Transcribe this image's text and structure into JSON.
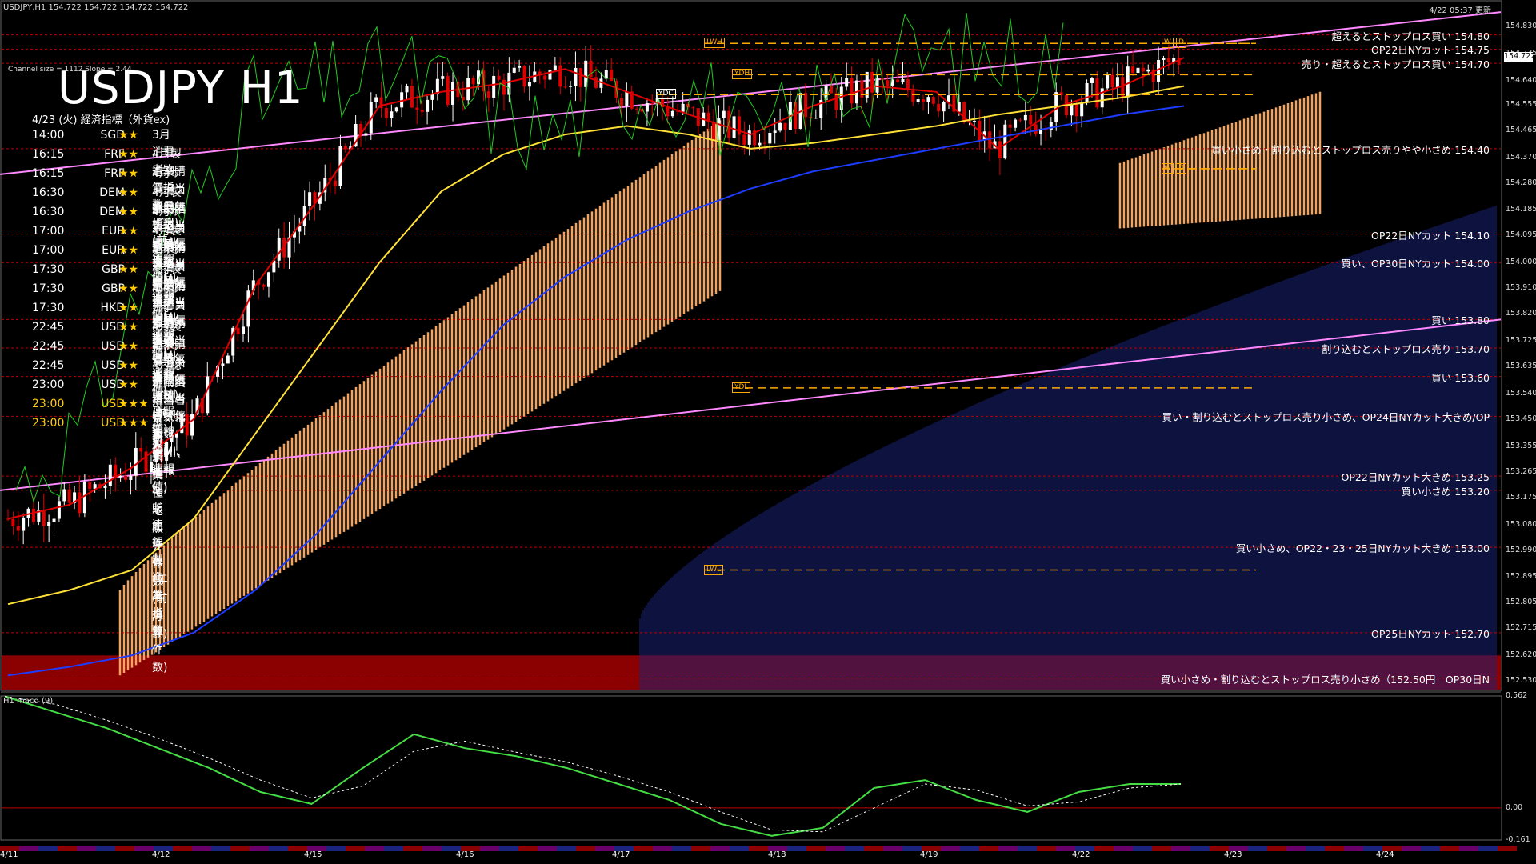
{
  "header": {
    "symbol_info": "USDJPY,H1  154.722 154.722 154.722 154.722",
    "timestamp": "4/22 05:37 更新",
    "channel_info": "Channel size = 1112 Slope = 2.44",
    "big_title": "USDJPY H1",
    "macd_label": "H1  macd (9)",
    "current_price": "154.722"
  },
  "econ": {
    "title": "4/23 (火) 経済指標（外貨ex)",
    "rows": [
      {
        "time": "14:00",
        "currency": "SGD",
        "stars": "★★",
        "event": "3月消費者物価指数(CPI)(前年比)",
        "level": "std"
      },
      {
        "time": "16:15",
        "currency": "FRF",
        "stars": "★★",
        "event": "4月製造業購買担当者景気指数(PMI、速報値)",
        "level": "std"
      },
      {
        "time": "16:15",
        "currency": "FRF",
        "stars": "★★",
        "event": "4月サービス部門購買担当者景気指数(PMI、速報値)",
        "level": "std"
      },
      {
        "time": "16:30",
        "currency": "DEM",
        "stars": "★★",
        "event": "4月製造業購買担当者景気指数(PMI、速報値)",
        "level": "std"
      },
      {
        "time": "16:30",
        "currency": "DEM",
        "stars": "★★",
        "event": "4月サービス部門購買担当者景気指数(PMI、速報値)",
        "level": "std"
      },
      {
        "time": "17:00",
        "currency": "EUR",
        "stars": "★★",
        "event": "4月製造業購買担当者景気指数(PMI、速報値)",
        "level": "std"
      },
      {
        "time": "17:00",
        "currency": "EUR",
        "stars": "★★",
        "event": "4月サービス部門購買担当者景気指数(PMI、速報値)",
        "level": "std"
      },
      {
        "time": "17:30",
        "currency": "GBP",
        "stars": "★★",
        "event": "4月製造業購買担当者景気指数(PMI、速報値)",
        "level": "std"
      },
      {
        "time": "17:30",
        "currency": "GBP",
        "stars": "★★",
        "event": "4月サービス部門購買担当者景気指数(PMI、速報値)",
        "level": "std"
      },
      {
        "time": "17:30",
        "currency": "HKD",
        "stars": "★★",
        "event": "3月消費者物価指数(CPI)(前年比)",
        "level": "std"
      },
      {
        "time": "22:45",
        "currency": "USD",
        "stars": "★★",
        "event": "4月製造業購買担当者景気指数(PMI、速報値)",
        "level": "std"
      },
      {
        "time": "22:45",
        "currency": "USD",
        "stars": "★★",
        "event": "4月サービス部門購買担当者景気指数(PMI、速報値)",
        "level": "std"
      },
      {
        "time": "22:45",
        "currency": "USD",
        "stars": "★★",
        "event": "4月総合購買担当者景気指数(PMI、速報値)",
        "level": "std"
      },
      {
        "time": "23:00",
        "currency": "USD",
        "stars": "★★",
        "event": "4月リッチモンド連銀製造業指数",
        "level": "std"
      },
      {
        "time": "23:00",
        "currency": "USD",
        "stars": "★★★",
        "event": "3月新築住宅販売件数(年率換算件数)",
        "level": "hi"
      },
      {
        "time": "23:00",
        "currency": "USD",
        "stars": "★★★",
        "event": "3月新築住宅販売件数(前月比)",
        "level": "hi"
      }
    ]
  },
  "annotations": [
    {
      "text": "超えるとストップロス買い 154.80",
      "price": 154.8
    },
    {
      "text": "OP22日NYカット 154.75",
      "price": 154.75
    },
    {
      "text": "売り・超えるとストップロス買い 154.70",
      "price": 154.7
    },
    {
      "text": "買い小さめ・割り込むとストップロス売りやや小さめ 154.40",
      "price": 154.4
    },
    {
      "text": "OP22日NYカット 154.10",
      "price": 154.1
    },
    {
      "text": "買い、OP30日NYカット 154.00",
      "price": 154.0
    },
    {
      "text": "買い 153.80",
      "price": 153.8
    },
    {
      "text": "割り込むとストップロス売り 153.70",
      "price": 153.7
    },
    {
      "text": "買い 153.60",
      "price": 153.6
    },
    {
      "text": "買い・割り込むとストップロス売り小さめ、OP24日NYカット大きめ/OP",
      "price": 153.46
    },
    {
      "text": "OP22日NYカット大きめ 153.25",
      "price": 153.25
    },
    {
      "text": "買い小さめ 153.20",
      "price": 153.2
    },
    {
      "text": "買い小さめ、OP22・23・25日NYカット大きめ 153.00",
      "price": 153.0
    },
    {
      "text": "OP25日NYカット 152.70",
      "price": 152.7
    },
    {
      "text": "買い小さめ・割り込むとストップロス売り小さめ（152.50円　OP30日N",
      "price": 152.54
    }
  ],
  "price_ticks": [
    "154.830",
    "154.735",
    "154.640",
    "154.555",
    "154.465",
    "154.370",
    "154.280",
    "154.185",
    "154.095",
    "154.000",
    "153.910",
    "153.820",
    "153.725",
    "153.635",
    "153.540",
    "153.450",
    "153.355",
    "153.265",
    "153.175",
    "153.080",
    "152.990",
    "152.895",
    "152.805",
    "152.715",
    "152.620",
    "152.530"
  ],
  "macd_ticks": [
    "0.562",
    "0.00",
    "-0.161"
  ],
  "date_ticks": [
    "4/11",
    "4/12",
    "4/15",
    "4/16",
    "4/17",
    "4/18",
    "4/19",
    "4/22",
    "4/23",
    "4/24"
  ],
  "level_boxes": [
    {
      "label": "LWH",
      "price": 154.77
    },
    {
      "label": "YDH",
      "price": 154.66
    },
    {
      "label": "YDC",
      "price": 154.59
    },
    {
      "label": "YDL",
      "price": 153.56
    },
    {
      "label": "LWL",
      "price": 152.92
    },
    {
      "label": "W",
      "price": 154.77
    },
    {
      "label": "D",
      "price": 154.77
    },
    {
      "label": "W",
      "price": 154.33
    },
    {
      "label": "D",
      "price": 154.33
    }
  ],
  "colors": {
    "background": "#000000",
    "bull_candle": "#ffffff",
    "bear_candle": "#e00000",
    "cloud_up": "#f4a460",
    "cloud_down": "#1a237e",
    "ma_yellow": "#ffe135",
    "ma_blue": "#1e3cff",
    "ma_red": "#e00000",
    "chikou": "#22cc22",
    "channel": "#ff88ff",
    "macd_line": "#44dd44",
    "macd_neg": "#ff88aa"
  },
  "chart_data": {
    "type": "line",
    "title": "USDJPY H1",
    "xlabel": "",
    "ylabel": "",
    "ylim": [
      152.5,
      154.9
    ],
    "x": [
      "4/11",
      "4/12",
      "4/15",
      "4/16",
      "4/17",
      "4/18",
      "4/19",
      "4/22",
      "4/23",
      "4/24"
    ],
    "series": [
      {
        "values": [
          153.1,
          153.15,
          153.28,
          153.45,
          153.92,
          154.22,
          154.55,
          154.6,
          154.63,
          154.68,
          154.6,
          154.52,
          154.45,
          154.55,
          154.62,
          154.6,
          154.4,
          154.55,
          154.62,
          154.72
        ]
      },
      {
        "values": [
          152.8,
          152.85,
          152.92,
          153.1,
          153.4,
          153.7,
          154.0,
          154.25,
          154.38,
          154.45,
          154.48,
          154.45,
          154.4,
          154.42,
          154.45,
          154.48,
          154.52,
          154.55,
          154.58,
          154.62
        ]
      },
      {
        "values": [
          152.55,
          152.58,
          152.62,
          152.7,
          152.85,
          153.05,
          153.3,
          153.55,
          153.78,
          153.95,
          154.08,
          154.18,
          154.26,
          154.32,
          154.36,
          154.4,
          154.44,
          154.48,
          154.52,
          154.55
        ]
      }
    ],
    "macd": {
      "ylim": [
        -0.161,
        0.562
      ],
      "values": [
        0.56,
        0.48,
        0.4,
        0.3,
        0.2,
        0.08,
        0.02,
        0.2,
        0.37,
        0.3,
        0.26,
        0.2,
        0.12,
        0.04,
        -0.08,
        -0.14,
        -0.1,
        0.1,
        0.14,
        0.04,
        -0.02,
        0.08,
        0.12,
        0.12
      ]
    }
  }
}
